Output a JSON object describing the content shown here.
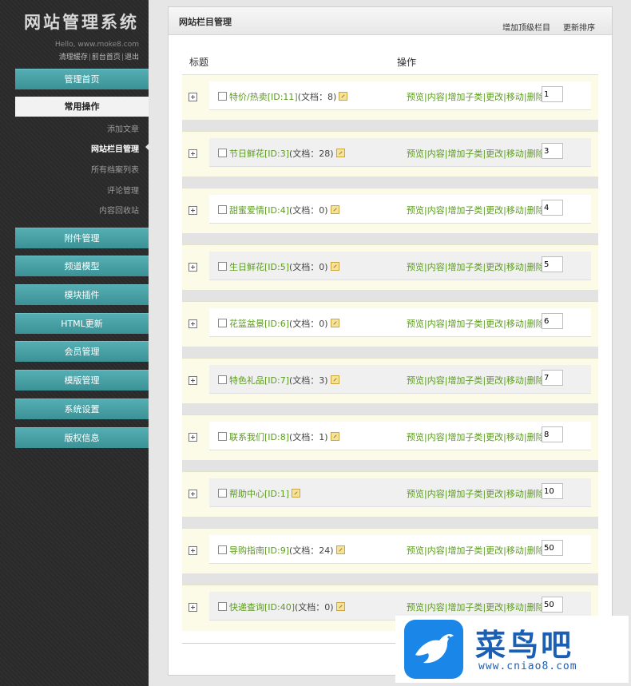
{
  "sidebar": {
    "system_title": "网站管理系统",
    "hello_line": "Hello, www.moke8.com",
    "user_links": [
      "清理缓存",
      "前台首页",
      "退出"
    ],
    "link_separator": "|",
    "nav_buttons": [
      "管理首页",
      "常用操作",
      "附件管理",
      "频道模型",
      "模块插件",
      "HTML更新",
      "会员管理",
      "模版管理",
      "系统设置",
      "版权信息"
    ],
    "sub_items": [
      "添加文章",
      "网站栏目管理",
      "所有档案列表",
      "评论管理",
      "内容回收站"
    ],
    "active_sub_item": "网站栏目管理"
  },
  "main": {
    "panel_title": "网站栏目管理",
    "add_top_category_link": "增加顶级栏目",
    "update_sort_link": "更新排序",
    "column_headers": {
      "title": "标题",
      "operations": "操作"
    },
    "operation_links": [
      "预览",
      "内容",
      "增加子类",
      "更改",
      "移动",
      "删除"
    ],
    "operation_separator": "|",
    "categories": [
      {
        "name": "特价/热卖[ID:11]",
        "count_text": "(文档：8)",
        "sort": "1"
      },
      {
        "name": "节日鲜花[ID:3]",
        "count_text": "(文档：28)",
        "sort": "3"
      },
      {
        "name": "甜蜜爱情[ID:4]",
        "count_text": "(文档：0)",
        "sort": "4"
      },
      {
        "name": "生日鲜花[ID:5]",
        "count_text": "(文档：0)",
        "sort": "5"
      },
      {
        "name": "花篮盆景[ID:6]",
        "count_text": "(文档：0)",
        "sort": "6"
      },
      {
        "name": "特色礼品[ID:7]",
        "count_text": "(文档：3)",
        "sort": "7"
      },
      {
        "name": "联系我们[ID:8]",
        "count_text": "(文档：1)",
        "sort": "8"
      },
      {
        "name": "帮助中心[ID:1]",
        "count_text": "",
        "sort": "10"
      },
      {
        "name": "导购指南[ID:9]",
        "count_text": "(文档：24)",
        "sort": "50"
      },
      {
        "name": "快递查询[ID:40]",
        "count_text": "(文档：0)",
        "sort": "50"
      }
    ]
  },
  "watermark": {
    "brand_text": "菜鸟吧",
    "url_text": "www.cniao8.com"
  },
  "colors": {
    "sidebar_bg": "#2b2b2b",
    "nav_button": "#3c9296",
    "link_green": "#5c9b1f",
    "row_bg": "#fbfbe8",
    "watermark_blue": "#1a86e8"
  }
}
